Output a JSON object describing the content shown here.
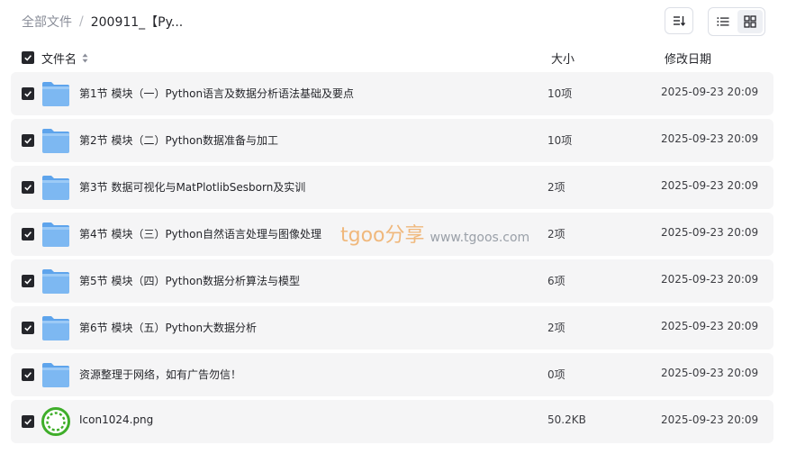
{
  "breadcrumb": {
    "root": "全部文件",
    "separator": "/",
    "current": "200911_【Py..."
  },
  "toolbar": {
    "sort_icon": "sort-icon",
    "list_view_icon": "list-view-icon",
    "grid_view_icon": "grid-view-icon",
    "active_view": "list"
  },
  "header": {
    "name": "文件名",
    "size": "大小",
    "date": "修改日期",
    "select_all_checked": true
  },
  "rows": [
    {
      "name": "第1节 模块（一）Python语言及数据分析语法基础及要点",
      "size": "10项",
      "date": "2025-09-23 20:09",
      "type": "folder",
      "checked": true
    },
    {
      "name": "第2节 模块（二）Python数据准备与加工",
      "size": "10项",
      "date": "2025-09-23 20:09",
      "type": "folder",
      "checked": true
    },
    {
      "name": "第3节 数据可视化与MatPlotlibSesborn及实训",
      "size": "2项",
      "date": "2025-09-23 20:09",
      "type": "folder",
      "checked": true
    },
    {
      "name": "第4节 模块（三）Python自然语言处理与图像处理",
      "size": "2项",
      "date": "2025-09-23 20:09",
      "type": "folder",
      "checked": true
    },
    {
      "name": "第5节 模块（四）Python数据分析算法与模型",
      "size": "6项",
      "date": "2025-09-23 20:09",
      "type": "folder",
      "checked": true
    },
    {
      "name": "第6节 模块（五）Python大数据分析",
      "size": "2项",
      "date": "2025-09-23 20:09",
      "type": "folder",
      "checked": true
    },
    {
      "name": "资源整理于网络，如有广告勿信！",
      "size": "0项",
      "date": "2025-09-23 20:09",
      "type": "folder",
      "checked": true
    },
    {
      "name": "Icon1024.png",
      "size": "50.2KB",
      "date": "2025-09-23 20:09",
      "type": "image",
      "checked": true
    }
  ],
  "watermark": {
    "brand": "tgoo分享",
    "url": "www.tgoos.com"
  },
  "colors": {
    "folder": "#7db8f2",
    "row_bg": "#f5f5f6",
    "checkbox": "#25262b",
    "image_icon": "#3fae2a",
    "watermark": "#f0b87c"
  }
}
